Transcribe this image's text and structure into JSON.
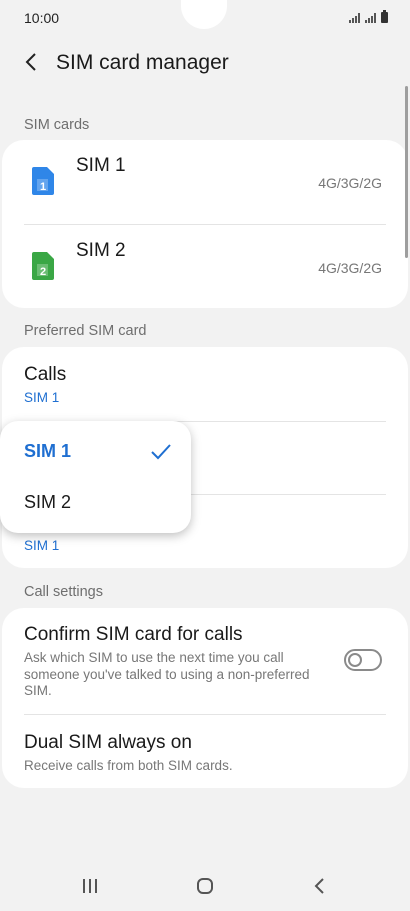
{
  "status": {
    "time": "10:00"
  },
  "header": {
    "title": "SIM card manager"
  },
  "sections": {
    "sim_cards": "SIM cards",
    "preferred": "Preferred SIM card",
    "call_settings": "Call settings"
  },
  "sim_cards": [
    {
      "name": "SIM 1",
      "network": "4G/3G/2G",
      "number": "1",
      "color": "#2f86e8"
    },
    {
      "name": "SIM 2",
      "network": "4G/3G/2G",
      "number": "2",
      "color": "#3aa745"
    }
  ],
  "preferred": {
    "calls_title": "Calls",
    "calls_value": "SIM 1",
    "data_value": "SIM 1"
  },
  "popup": {
    "options": [
      "SIM 1",
      "SIM 2"
    ],
    "selected": "SIM 1"
  },
  "call_settings": {
    "confirm_title": "Confirm SIM card for calls",
    "confirm_desc": "Ask which SIM to use the next time you call someone you've talked to using a non-preferred SIM.",
    "confirm_enabled": false,
    "dual_title": "Dual SIM always on",
    "dual_desc": "Receive calls from both SIM cards."
  },
  "colors": {
    "accent": "#1f6fd1",
    "background": "#f2f2f2"
  },
  "icons": {
    "back": "chevron-left-icon",
    "check": "check-icon",
    "nav": [
      "recents-icon",
      "home-icon",
      "back-icon"
    ]
  }
}
